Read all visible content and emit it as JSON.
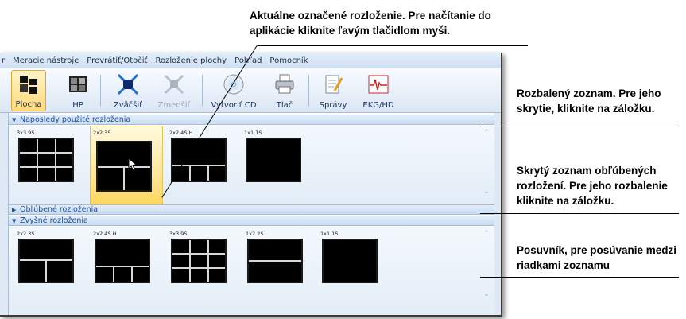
{
  "annotations": {
    "top": "Aktuálne označené rozloženie. Pre načítanie do aplikácie kliknite ľavým tlačidlom myši.",
    "expanded": "Rozbalený zoznam. Pre jeho skrytie, kliknite na záložku.",
    "hidden": "Skrytý zoznam obľúbených rozložení. Pre jeho rozbalenie kliknite na záložku.",
    "scroll": "Posuvník, pre posúvanie medzi riadkami zoznamu"
  },
  "menu": {
    "items": [
      "r",
      "Meracie nástroje",
      "Prevrátiť/Otočiť",
      "Rozloženie plochy",
      "Pohľad",
      "Pomocník"
    ]
  },
  "toolbar": {
    "buttons": [
      {
        "label": "Plocha",
        "icon": "desktop-layout-icon",
        "active": true
      },
      {
        "label": "HP",
        "icon": "hanging-protocol-icon"
      },
      {
        "label": "Zväčšiť",
        "icon": "zoom-in-icon"
      },
      {
        "label": "Zmenšiť",
        "icon": "zoom-out-icon",
        "disabled": true
      },
      {
        "label": "Vytvoriť CD",
        "icon": "cd-icon"
      },
      {
        "label": "Tlač",
        "icon": "printer-icon"
      },
      {
        "label": "Správy",
        "icon": "report-icon"
      },
      {
        "label": "EKG/HD",
        "icon": "ecg-icon"
      }
    ]
  },
  "sections": {
    "recent": {
      "title": "Naposledy použité rozloženia",
      "expanded": true,
      "layouts": [
        {
          "label": "3x3 9S",
          "grid": "3x3"
        },
        {
          "label": "2x2 3S",
          "grid": "1+2",
          "selected": true
        },
        {
          "label": "2x2 4S H",
          "grid": "1+3"
        },
        {
          "label": "1x1 1S",
          "grid": "1"
        }
      ]
    },
    "favorites": {
      "title": "Obľúbené rozloženia",
      "expanded": false
    },
    "others": {
      "title": "Zvyšné rozloženia",
      "expanded": true,
      "layouts": [
        {
          "label": "2x2 3S",
          "grid": "1+2"
        },
        {
          "label": "2x2 4S H",
          "grid": "1+3"
        },
        {
          "label": "3x3 9S",
          "grid": "3x3"
        },
        {
          "label": "1x2 2S",
          "grid": "2rows"
        },
        {
          "label": "1x1 1S",
          "grid": "1"
        }
      ]
    }
  },
  "colors": {
    "accent": "#1d4f9a",
    "selection": "#ffd65e",
    "panel": "#e3edf7"
  }
}
